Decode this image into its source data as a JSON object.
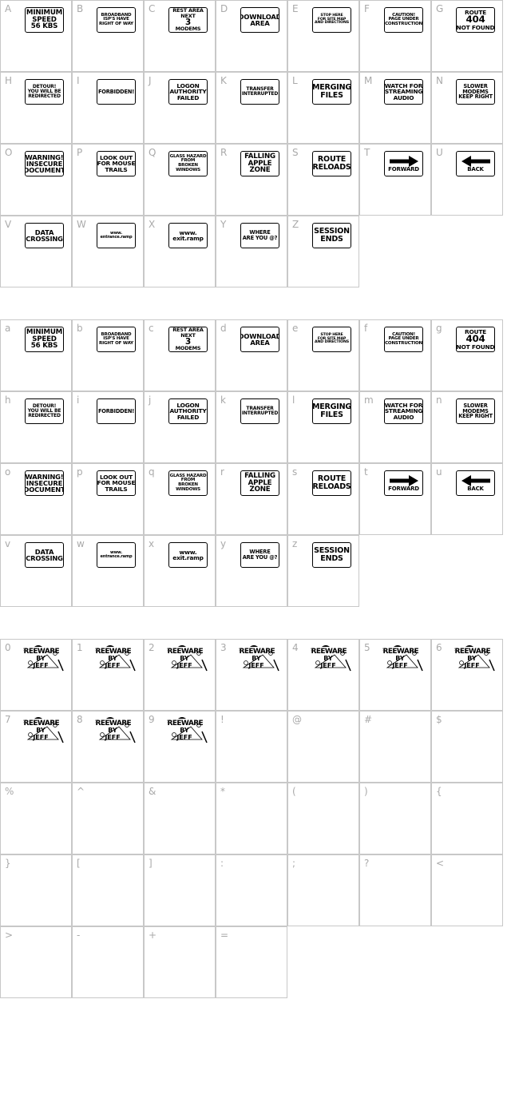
{
  "sections": [
    {
      "cells": [
        {
          "char": "A",
          "sign": [
            "MINIMUM",
            "SPEED",
            "56 KBS"
          ]
        },
        {
          "char": "B",
          "sign": [
            "BROADBAND",
            "ISP'S HAVE",
            "RIGHT OF WAY"
          ]
        },
        {
          "char": "C",
          "sign": [
            "REST AREA",
            "NEXT",
            "3",
            "MODEMS"
          ]
        },
        {
          "char": "D",
          "sign": [
            "DOWNLOAD",
            "AREA"
          ]
        },
        {
          "char": "E",
          "sign": [
            "STOP HERE",
            "FOR SITE MAP",
            "AND DIRECTIONS"
          ]
        },
        {
          "char": "F",
          "sign": [
            "CAUTION!",
            "PAGE UNDER",
            "CONSTRUCTION"
          ]
        },
        {
          "char": "G",
          "sign": [
            "ROUTE",
            "404",
            "NOT FOUND"
          ]
        },
        {
          "char": "H",
          "sign": [
            "DETOUR!",
            "YOU WILL BE",
            "REDIRECTED"
          ]
        },
        {
          "char": "I",
          "sign": [
            "FORBIDDEN!"
          ]
        },
        {
          "char": "J",
          "sign": [
            "LOGON",
            "AUTHORITY",
            "FAILED"
          ]
        },
        {
          "char": "K",
          "sign": [
            "TRANSFER",
            "INTERRUPTED"
          ]
        },
        {
          "char": "L",
          "sign": [
            "MERGING",
            "FILES"
          ]
        },
        {
          "char": "M",
          "sign": [
            "WATCH FOR",
            "STREAMING",
            "AUDIO"
          ]
        },
        {
          "char": "N",
          "sign": [
            "SLOWER",
            "MODEMS",
            "KEEP RIGHT"
          ]
        },
        {
          "char": "O",
          "sign": [
            "WARNING!",
            "INSECURE",
            "DOCUMENT"
          ]
        },
        {
          "char": "P",
          "sign": [
            "LOOK OUT",
            "FOR MOUSE",
            "TRAILS"
          ]
        },
        {
          "char": "Q",
          "sign": [
            "GLASS HAZARD",
            "FROM",
            "BROKEN",
            "WINDOWS"
          ]
        },
        {
          "char": "R",
          "sign": [
            "FALLING",
            "APPLE",
            "ZONE"
          ]
        },
        {
          "char": "S",
          "sign": [
            "ROUTE",
            "RELOADS"
          ]
        },
        {
          "char": "T",
          "sign": [
            "FORWARD"
          ],
          "arrow": "right"
        },
        {
          "char": "U",
          "sign": [
            "BACK"
          ],
          "arrow": "left"
        },
        {
          "char": "V",
          "sign": [
            "DATA",
            "CROSSING"
          ]
        },
        {
          "char": "W",
          "sign": [
            "www.",
            "entrance.ramp"
          ]
        },
        {
          "char": "X",
          "sign": [
            "www.",
            "exit.ramp"
          ]
        },
        {
          "char": "Y",
          "sign": [
            "WHERE",
            "ARE YOU @?"
          ]
        },
        {
          "char": "Z",
          "sign": [
            "SESSION",
            "ENDS"
          ]
        }
      ]
    },
    {
      "cells": [
        {
          "char": "a",
          "sign": [
            "MINIMUM",
            "SPEED",
            "56 KBS"
          ]
        },
        {
          "char": "b",
          "sign": [
            "BROADBAND",
            "ISP'S HAVE",
            "RIGHT OF WAY"
          ]
        },
        {
          "char": "c",
          "sign": [
            "REST AREA",
            "NEXT",
            "3",
            "MODEMS"
          ]
        },
        {
          "char": "d",
          "sign": [
            "DOWNLOAD",
            "AREA"
          ]
        },
        {
          "char": "e",
          "sign": [
            "STOP HERE",
            "FOR SITE MAP",
            "AND DIRECTIONS"
          ]
        },
        {
          "char": "f",
          "sign": [
            "CAUTION!",
            "PAGE UNDER",
            "CONSTRUCTION"
          ]
        },
        {
          "char": "g",
          "sign": [
            "ROUTE",
            "404",
            "NOT FOUND"
          ]
        },
        {
          "char": "h",
          "sign": [
            "DETOUR!",
            "YOU WILL BE",
            "REDIRECTED"
          ]
        },
        {
          "char": "i",
          "sign": [
            "FORBIDDEN!"
          ]
        },
        {
          "char": "j",
          "sign": [
            "LOGON",
            "AUTHORITY",
            "FAILED"
          ]
        },
        {
          "char": "k",
          "sign": [
            "TRANSFER",
            "INTERRUPTED"
          ]
        },
        {
          "char": "l",
          "sign": [
            "MERGING",
            "FILES"
          ]
        },
        {
          "char": "m",
          "sign": [
            "WATCH FOR",
            "STREAMING",
            "AUDIO"
          ]
        },
        {
          "char": "n",
          "sign": [
            "SLOWER",
            "MODEMS",
            "KEEP RIGHT"
          ]
        },
        {
          "char": "o",
          "sign": [
            "WARNING!",
            "INSECURE",
            "DOCUMENT"
          ]
        },
        {
          "char": "p",
          "sign": [
            "LOOK OUT",
            "FOR MOUSE",
            "TRAILS"
          ]
        },
        {
          "char": "q",
          "sign": [
            "GLASS HAZARD",
            "FROM",
            "BROKEN",
            "WINDOWS"
          ]
        },
        {
          "char": "r",
          "sign": [
            "FALLING",
            "APPLE",
            "ZONE"
          ]
        },
        {
          "char": "s",
          "sign": [
            "ROUTE",
            "RELOADS"
          ]
        },
        {
          "char": "t",
          "sign": [
            "FORWARD"
          ],
          "arrow": "right"
        },
        {
          "char": "u",
          "sign": [
            "BACK"
          ],
          "arrow": "left"
        },
        {
          "char": "v",
          "sign": [
            "DATA",
            "CROSSING"
          ]
        },
        {
          "char": "w",
          "sign": [
            "www.",
            "entrance.ramp"
          ]
        },
        {
          "char": "x",
          "sign": [
            "www.",
            "exit.ramp"
          ]
        },
        {
          "char": "y",
          "sign": [
            "WHERE",
            "ARE YOU @?"
          ]
        },
        {
          "char": "z",
          "sign": [
            "SESSION",
            "ENDS"
          ]
        }
      ]
    },
    {
      "cells": [
        {
          "char": "0",
          "logo": [
            "FREEWARE",
            "BY",
            "JEFF"
          ]
        },
        {
          "char": "1",
          "logo": [
            "FREEWARE",
            "BY",
            "JEFF"
          ]
        },
        {
          "char": "2",
          "logo": [
            "FREEWARE",
            "BY",
            "JEFF"
          ]
        },
        {
          "char": "3",
          "logo": [
            "FREEWARE",
            "BY",
            "JEFF"
          ]
        },
        {
          "char": "4",
          "logo": [
            "FREEWARE",
            "BY",
            "JEFF"
          ]
        },
        {
          "char": "5",
          "logo": [
            "FREEWARE",
            "BY",
            "JEFF"
          ]
        },
        {
          "char": "6",
          "logo": [
            "FREEWARE",
            "BY",
            "JEFF"
          ]
        },
        {
          "char": "7",
          "logo": [
            "FREEWARE",
            "BY",
            "JEFF"
          ]
        },
        {
          "char": "8",
          "logo": [
            "FREEWARE",
            "BY",
            "JEFF"
          ]
        },
        {
          "char": "9",
          "logo": [
            "FREEWARE",
            "BY",
            "JEFF"
          ]
        },
        {
          "char": "!"
        },
        {
          "char": "@"
        },
        {
          "char": "#"
        },
        {
          "char": "$"
        },
        {
          "char": "%"
        },
        {
          "char": "^"
        },
        {
          "char": "&"
        },
        {
          "char": "*"
        },
        {
          "char": "("
        },
        {
          "char": ")"
        },
        {
          "char": "{"
        },
        {
          "char": "}"
        },
        {
          "char": "["
        },
        {
          "char": "]"
        },
        {
          "char": ":"
        },
        {
          "char": ";"
        },
        {
          "char": "?"
        },
        {
          "char": "<"
        },
        {
          "char": ">"
        },
        {
          "char": "-"
        },
        {
          "char": "+"
        },
        {
          "char": "="
        }
      ]
    }
  ]
}
